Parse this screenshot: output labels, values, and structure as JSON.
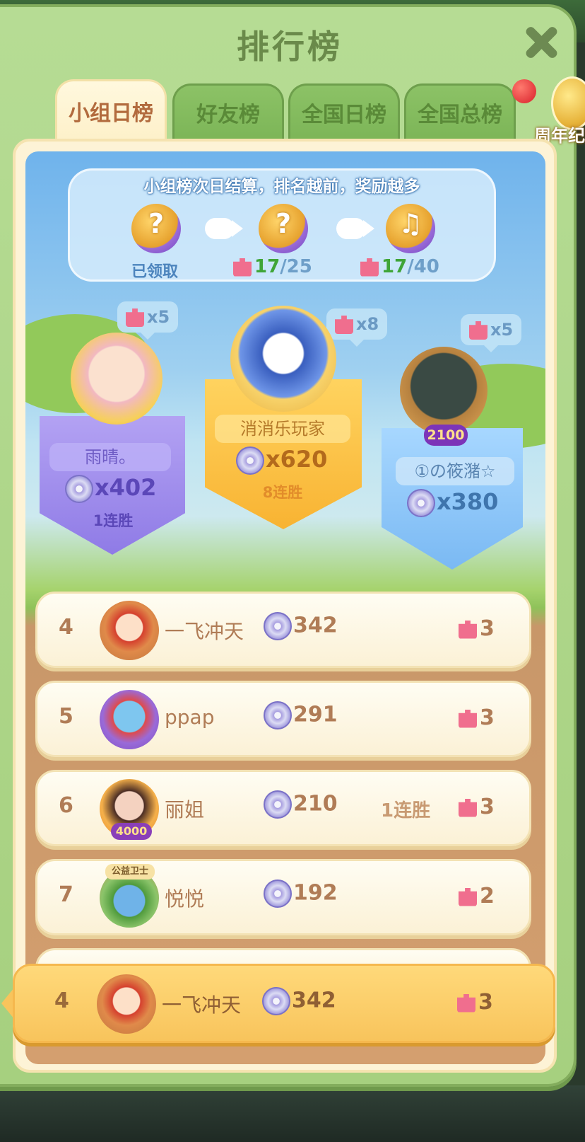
{
  "title": "排行榜",
  "tabs": [
    {
      "label": "小组日榜",
      "active": true
    },
    {
      "label": "好友榜",
      "active": false
    },
    {
      "label": "全国日榜",
      "active": false
    },
    {
      "label": "全国总榜",
      "active": false
    }
  ],
  "anniversary": {
    "label": "周年纪"
  },
  "banner": {
    "text": "小组榜次日结算，排名越前，奖励越多",
    "rewards": [
      {
        "status": "已领取",
        "icon": "mystery-reward-icon"
      },
      {
        "current": "17",
        "total": "/25",
        "icon": "guitar-reward-icon"
      },
      {
        "current": "17",
        "total": "/40",
        "icon": "guitar-reward-icon"
      }
    ]
  },
  "podium": [
    {
      "place": 1,
      "name": "消消乐玩家",
      "score": "x620",
      "streak": "8连胜",
      "pieces": "x8"
    },
    {
      "place": 2,
      "name": "雨晴。",
      "score": "x402",
      "streak": "1连胜",
      "pieces": "x5"
    },
    {
      "place": 3,
      "name": "①の筱潴☆",
      "score": "x380",
      "streak": "",
      "pieces": "x5",
      "badge": "2100"
    }
  ],
  "rows": [
    {
      "rank": "4",
      "name": "一飞冲天",
      "score": "342",
      "streak": "",
      "pieces": "3"
    },
    {
      "rank": "5",
      "name": "ppap",
      "score": "291",
      "streak": "",
      "pieces": "3"
    },
    {
      "rank": "6",
      "name": "丽姐",
      "score": "210",
      "streak": "1连胜",
      "pieces": "3",
      "badge": "4000"
    },
    {
      "rank": "7",
      "name": "悦悦",
      "score": "192",
      "streak": "",
      "pieces": "2",
      "badge": "公益卫士"
    }
  ],
  "me": {
    "rank": "4",
    "name": "一飞冲天",
    "score": "342",
    "pieces": "3"
  },
  "colors": {
    "panel_green": "#a6d07f",
    "tab_active_text": "#b26b3e",
    "gold_pedestal": "#f8b332",
    "purple_pedestal": "#8f7be6",
    "blue_pedestal": "#7ab9f3",
    "me_row": "#f8c45c"
  }
}
